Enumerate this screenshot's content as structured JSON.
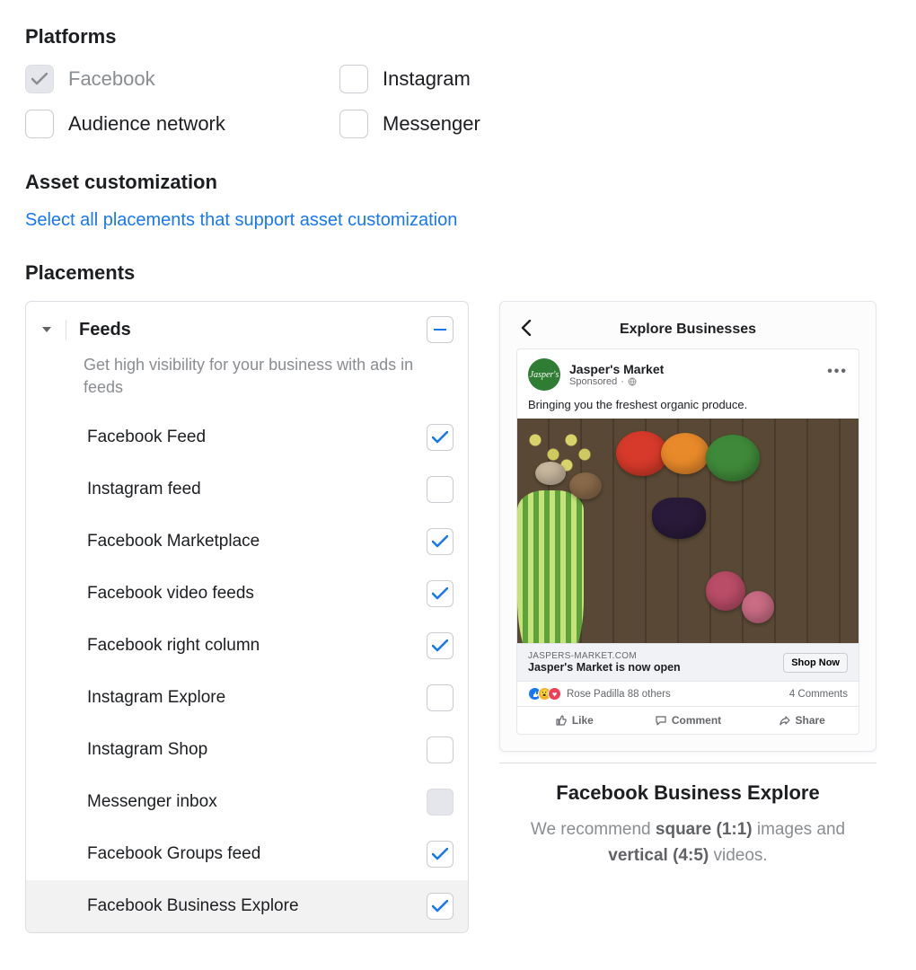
{
  "sections": {
    "platforms_title": "Platforms",
    "asset_customization_title": "Asset customization",
    "asset_customization_link": "Select all placements that support asset customization",
    "placements_title": "Placements"
  },
  "platforms": [
    {
      "label": "Facebook",
      "checked": true,
      "disabled": true
    },
    {
      "label": "Instagram",
      "checked": false,
      "disabled": false
    },
    {
      "label": "Audience network",
      "checked": false,
      "disabled": false
    },
    {
      "label": "Messenger",
      "checked": false,
      "disabled": false
    }
  ],
  "placementGroup": {
    "title": "Feeds",
    "desc": "Get high visibility for your business with ads in feeds",
    "tristate": "partial"
  },
  "placements": [
    {
      "label": "Facebook Feed",
      "state": "checked"
    },
    {
      "label": "Instagram feed",
      "state": "unchecked"
    },
    {
      "label": "Facebook Marketplace",
      "state": "checked"
    },
    {
      "label": "Facebook video feeds",
      "state": "checked"
    },
    {
      "label": "Facebook right column",
      "state": "checked"
    },
    {
      "label": "Instagram Explore",
      "state": "unchecked"
    },
    {
      "label": "Instagram Shop",
      "state": "unchecked"
    },
    {
      "label": "Messenger inbox",
      "state": "disabled"
    },
    {
      "label": "Facebook Groups feed",
      "state": "checked"
    },
    {
      "label": "Facebook Business Explore",
      "state": "checked",
      "selected": true
    }
  ],
  "preview": {
    "topbar_title": "Explore Businesses",
    "page_name": "Jasper's Market",
    "avatar_text": "Jasper's",
    "sponsored": "Sponsored",
    "post_text": "Bringing you the freshest organic produce.",
    "link_domain": "JASPERS-MARKET.COM",
    "link_headline": "Jasper's Market is now open",
    "cta": "Shop Now",
    "reactions_text": "Rose Padilla 88 others",
    "comments_text": "4 Comments",
    "actions": {
      "like": "Like",
      "comment": "Comment",
      "share": "Share"
    },
    "title": "Facebook Business Explore",
    "reco_prefix": "We recommend ",
    "reco_sq": "square (1:1)",
    "reco_mid": " images and ",
    "reco_vert": "vertical (4:5)",
    "reco_suffix": " videos."
  }
}
